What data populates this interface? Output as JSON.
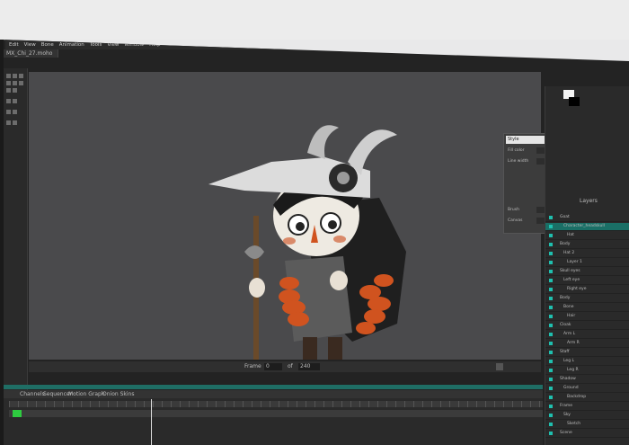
{
  "menu": [
    "Edit",
    "View",
    "Bone",
    "Animation",
    "Tools",
    "View",
    "Window",
    "Help"
  ],
  "document_tab": "MX_Chi_27.moho",
  "dialog": {
    "title": "Style",
    "fields": [
      "Fill color",
      "Line width",
      "Brush",
      "Canvas"
    ]
  },
  "right_panel": {
    "section_title": "Layers",
    "layers": [
      "Goat",
      "Character_headskull",
      "Hat",
      "Body",
      "Hat 2",
      "Layer 1",
      "Skull eyes",
      "Left eye",
      "Right eye",
      "Body",
      "Bone",
      "Hair",
      "Cloak",
      "Arm L",
      "Arm R",
      "Staff",
      "Leg L",
      "Leg R",
      "Shadow",
      "Ground",
      "Backdrop",
      "Frame",
      "Sky",
      "Sketch",
      "Scene"
    ]
  },
  "timeline": {
    "tabs": [
      "Channels",
      "Sequencer",
      "Motion Graph",
      "Onion Skins"
    ],
    "frame_label": "Frame",
    "frame_value": "0",
    "of_label": "of",
    "total_frames": "240"
  },
  "colors": {
    "accent": "#1fbfae",
    "key_green": "#2ecc40",
    "canvas_bg": "#4a4a4c",
    "ui_dark": "#2a2a2a",
    "close_red": "#c0392b"
  },
  "icons": [
    "select-icon",
    "bone-icon",
    "brush-icon",
    "fill-icon",
    "eye-icon",
    "lock-icon",
    "play-icon",
    "close-icon"
  ]
}
